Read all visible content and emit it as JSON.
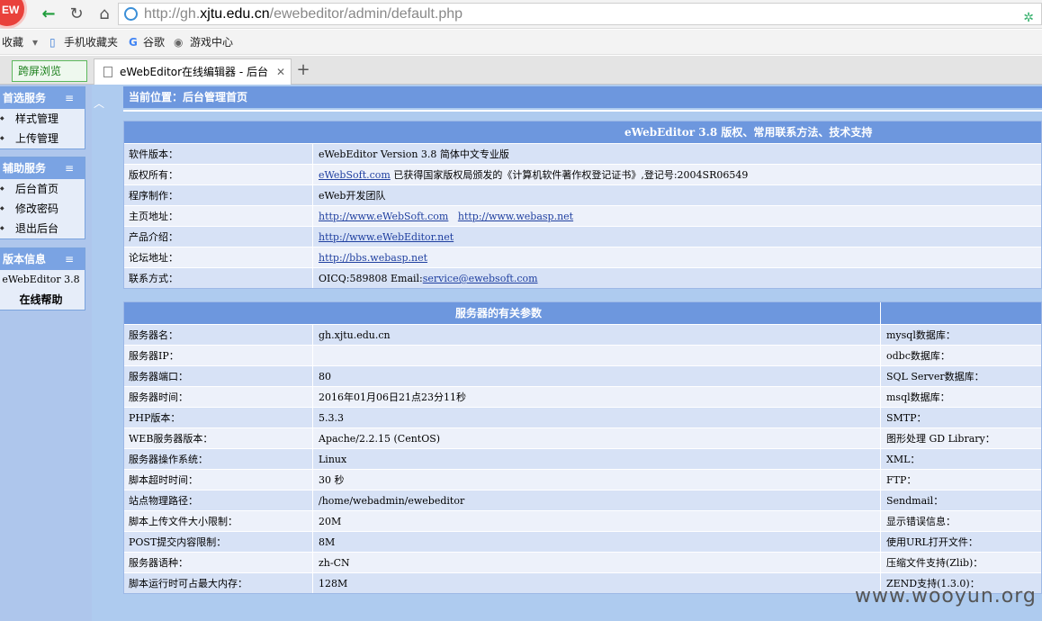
{
  "browser": {
    "logo_text": "EW",
    "url_prefix": "http://gh.",
    "url_host": "xjtu.edu.cn",
    "url_path": "/ewebeditor/admin/default.php"
  },
  "bookmarks": [
    "收藏",
    "手机收藏夹",
    "谷歌",
    "游戏中心"
  ],
  "tabs": {
    "cross_screen": "跨屏浏览",
    "active_title": "eWebEditor在线编辑器 - 后台",
    "new_tab": "+"
  },
  "sidebar": {
    "group1": {
      "title": "首选服务",
      "items": [
        "样式管理",
        "上传管理"
      ]
    },
    "group2": {
      "title": "辅助服务",
      "items": [
        "后台首页",
        "修改密码",
        "退出后台"
      ]
    },
    "group3": {
      "title": "版本信息",
      "version": "eWebEditor 3.8",
      "help": "在线帮助"
    }
  },
  "location": "当前位置：后台管理首页",
  "info": {
    "header": "eWebEditor 3.8 版权、常用联系方法、技术支持",
    "rows": [
      {
        "k": "软件版本：",
        "v": "eWebEditor Version 3.8 简体中文专业版"
      },
      {
        "k": "版权所有：",
        "link": "eWebSoft.com",
        "v": "  已获得国家版权局颁发的《计算机软件著作权登记证书》,登记号:2004SR06549"
      },
      {
        "k": "程序制作：",
        "v": "eWeb开发团队"
      },
      {
        "k": "主页地址：",
        "link": "http://www.eWebSoft.com",
        "link2": "http://www.webasp.net"
      },
      {
        "k": "产品介绍：",
        "link": "http://www.eWebEditor.net"
      },
      {
        "k": "论坛地址：",
        "link": "http://bbs.webasp.net"
      },
      {
        "k": "联系方式：",
        "v": "OICQ:589808    Email:",
        "link": "service@ewebsoft.com"
      }
    ]
  },
  "server": {
    "header": "服务器的有关参数",
    "rows": [
      {
        "k": "服务器名：",
        "v": "gh.xjtu.edu.cn",
        "k2": "mysql数据库："
      },
      {
        "k": "服务器IP：",
        "v": "",
        "k2": "odbc数据库："
      },
      {
        "k": "服务器端口：",
        "v": "80",
        "k2": "SQL Server数据库："
      },
      {
        "k": "服务器时间：",
        "v": "2016年01月06日21点23分11秒",
        "k2": "msql数据库："
      },
      {
        "k": "PHP版本：",
        "v": "5.3.3",
        "k2": "SMTP："
      },
      {
        "k": "WEB服务器版本：",
        "v": "Apache/2.2.15 (CentOS)",
        "k2": "图形处理 GD Library："
      },
      {
        "k": "服务器操作系统：",
        "v": "Linux",
        "k2": "XML："
      },
      {
        "k": "脚本超时时间：",
        "v": "30 秒",
        "k2": "FTP："
      },
      {
        "k": "站点物理路径：",
        "v": "/home/webadmin/ewebeditor",
        "k2": "Sendmail："
      },
      {
        "k": "脚本上传文件大小限制：",
        "v": "20M",
        "k2": "显示错误信息："
      },
      {
        "k": "POST提交内容限制：",
        "v": "8M",
        "k2": "使用URL打开文件："
      },
      {
        "k": "服务器语种：",
        "v": "zh-CN",
        "k2": "压缩文件支持(Zlib)："
      },
      {
        "k": "脚本运行时可占最大内存：",
        "v": "128M",
        "k2": "ZEND支持(1.3.0)："
      }
    ]
  },
  "watermark": "www.wooyun.org"
}
